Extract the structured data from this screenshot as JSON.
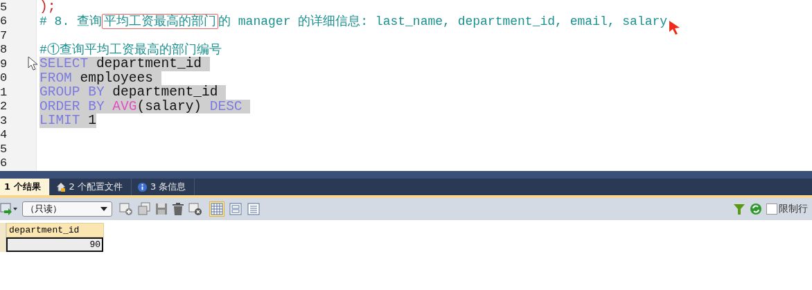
{
  "editor": {
    "lines": [
      {
        "number": "5",
        "selected": false,
        "tokens": [
          {
            "kind": "punct",
            "text": ");"
          }
        ]
      },
      {
        "number": "6",
        "selected": false,
        "tokens": [
          {
            "kind": "comment",
            "text": "# 8. 查询"
          },
          {
            "kind": "comment-boxed",
            "text": "平均工资最高的部门"
          },
          {
            "kind": "comment",
            "text": "的 manager 的详细信息: last_name, department_id, email, salary"
          }
        ]
      },
      {
        "number": "7"
      },
      {
        "number": "8",
        "selected": false,
        "tokens": [
          {
            "kind": "comment",
            "text": "#①查询平均工资最高的部门编号"
          }
        ]
      },
      {
        "number": "9",
        "selected": true,
        "tokens": [
          {
            "kind": "keyword",
            "text": "SELECT"
          },
          {
            "kind": "plain",
            "text": " department_id "
          }
        ]
      },
      {
        "number": "0",
        "selected": true,
        "tokens": [
          {
            "kind": "keyword",
            "text": "FROM"
          },
          {
            "kind": "plain",
            "text": " employees "
          }
        ]
      },
      {
        "number": "1",
        "selected": true,
        "tokens": [
          {
            "kind": "keyword",
            "text": "GROUP BY"
          },
          {
            "kind": "plain",
            "text": " department_id "
          }
        ]
      },
      {
        "number": "2",
        "selected": true,
        "tokens": [
          {
            "kind": "keyword",
            "text": "ORDER BY "
          },
          {
            "kind": "function",
            "text": "AVG"
          },
          {
            "kind": "plain",
            "text": "(salary) "
          },
          {
            "kind": "keyword",
            "text": "DESC "
          }
        ]
      },
      {
        "number": "3",
        "selected": true,
        "tokens": [
          {
            "kind": "keyword",
            "text": "LIMIT"
          },
          {
            "kind": "plain",
            "text": " 1"
          }
        ]
      },
      {
        "number": "4"
      },
      {
        "number": "5"
      },
      {
        "number": "6"
      }
    ]
  },
  "result_tabs": [
    {
      "label": "1 个结果",
      "selected": true
    },
    {
      "label": "2 个配置文件",
      "selected": false
    },
    {
      "label": "3 条信息",
      "selected": false
    }
  ],
  "toolbar": {
    "mode_select": "（只读）",
    "limit_rows": {
      "label": "限制行",
      "checked": false
    }
  },
  "grid": {
    "columns": [
      "department_id"
    ],
    "rows": [
      [
        "90"
      ]
    ]
  }
}
